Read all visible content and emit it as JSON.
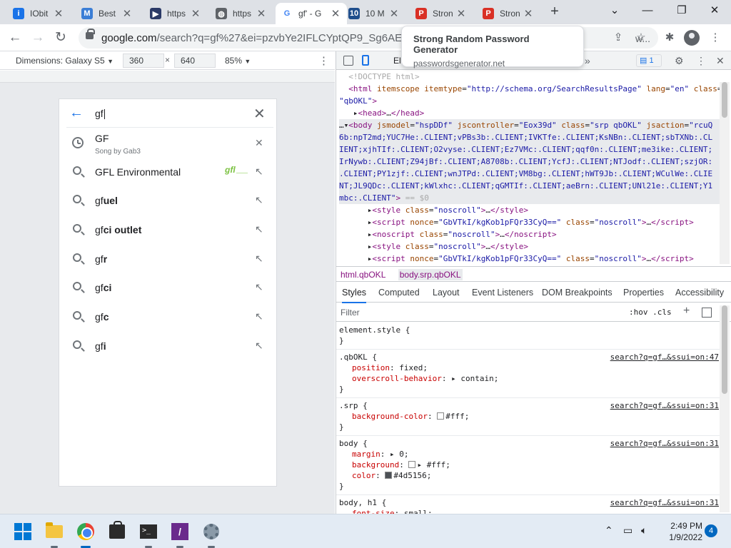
{
  "tabs": [
    {
      "title": "IObit",
      "favicon_color": "#1a73e8",
      "favicon_char": "i"
    },
    {
      "title": "Best S",
      "favicon_color": "#3b7ed6",
      "favicon_char": "M"
    },
    {
      "title": "https",
      "favicon_color": "#2b3a67",
      "favicon_char": "▶"
    },
    {
      "title": "https",
      "favicon_color": "#5f6368",
      "favicon_char": "◍"
    },
    {
      "title": "gf' - G",
      "favicon_color": "#ffffff",
      "favicon_char": "G"
    },
    {
      "title": "10 M",
      "favicon_color": "#1f4e8c",
      "favicon_char": "10"
    },
    {
      "title": "Stron",
      "favicon_color": "#d93025",
      "favicon_char": "P"
    },
    {
      "title": "Stron",
      "favicon_color": "#d93025",
      "favicon_char": "P"
    }
  ],
  "window_controls": {
    "dropdown": "⌄",
    "minimize": "—",
    "maximize": "❐",
    "close": "✕"
  },
  "address": {
    "host": "google.com",
    "path": "/search?q=gf%27&ei=pzvbYe2IFLCYptQP9_Sg6AE&gs_s",
    "tail": "w..."
  },
  "tooltip": {
    "title": "Strong Random Password Generator",
    "url": "passwordsgenerator.net"
  },
  "device_toolbar": {
    "label": "Dimensions: Galaxy S5",
    "width": "360",
    "height": "640",
    "times": "×",
    "zoom": "85%"
  },
  "search": {
    "query": "gf"
  },
  "suggestions": [
    {
      "type": "history",
      "text": "GF",
      "bold": "",
      "subtitle": "Song by Gab3",
      "action": "✕"
    },
    {
      "type": "search",
      "text": "GFL Environmental",
      "bold": "",
      "subtitle": "",
      "action": "↖",
      "logo": "gfl"
    },
    {
      "type": "search",
      "text": "gf",
      "bold": "uel",
      "subtitle": "",
      "action": "↖"
    },
    {
      "type": "search",
      "text": "gf",
      "bold": "ci outlet",
      "subtitle": "",
      "action": "↖"
    },
    {
      "type": "search",
      "text": "gf",
      "bold": "r",
      "subtitle": "",
      "action": "↖"
    },
    {
      "type": "search",
      "text": "gf",
      "bold": "ci",
      "subtitle": "",
      "action": "↖"
    },
    {
      "type": "search",
      "text": "gf",
      "bold": "c",
      "subtitle": "",
      "action": "↖"
    },
    {
      "type": "search",
      "text": "gf",
      "bold": "i",
      "subtitle": "",
      "action": "↖"
    }
  ],
  "devtools": {
    "elements_tab": "El",
    "issues_count": "1",
    "more_tabs": "»",
    "breadcrumbs": [
      "html.qbOKL",
      "body.srp.qbOKL"
    ],
    "style_tabs": [
      "Styles",
      "Computed",
      "Layout",
      "Event Listeners",
      "DOM Breakpoints",
      "Properties",
      "Accessibility"
    ],
    "filter_placeholder": "Filter",
    "hov_cls": ":hov  .cls",
    "rules": [
      {
        "selector": "element.style {",
        "source": "",
        "props": [],
        "close": "}"
      },
      {
        "selector": ".qbOKL {",
        "source": "search?q=gf…&ssui=on:47",
        "props": [
          {
            "name": "position",
            "value": "fixed;"
          },
          {
            "name": "overscroll-behavior",
            "value": "▸ contain;"
          }
        ],
        "close": "}"
      },
      {
        "selector": ".srp {",
        "source": "search?q=gf…&ssui=on:31",
        "props": [
          {
            "name": "background-color",
            "value": "#fff;",
            "swatch": "#ffffff"
          }
        ],
        "close": "}"
      },
      {
        "selector": "body {",
        "source": "search?q=gf…&ssui=on:31",
        "props": [
          {
            "name": "margin",
            "value": "▸ 0;"
          },
          {
            "name": "background",
            "value": "▸ #fff;",
            "swatch": "#ffffff"
          },
          {
            "name": "color",
            "value": "#4d5156;",
            "swatch": "#4d5156"
          }
        ],
        "close": "}"
      },
      {
        "selector": "body, h1 {",
        "source": "search?q=gf…&ssui=on:31",
        "props": [
          {
            "name": "font-size",
            "value": "small;"
          }
        ],
        "close": ""
      }
    ]
  },
  "taskbar": {
    "time": "2:49 PM",
    "date": "1/9/2022",
    "notifications": "4"
  }
}
